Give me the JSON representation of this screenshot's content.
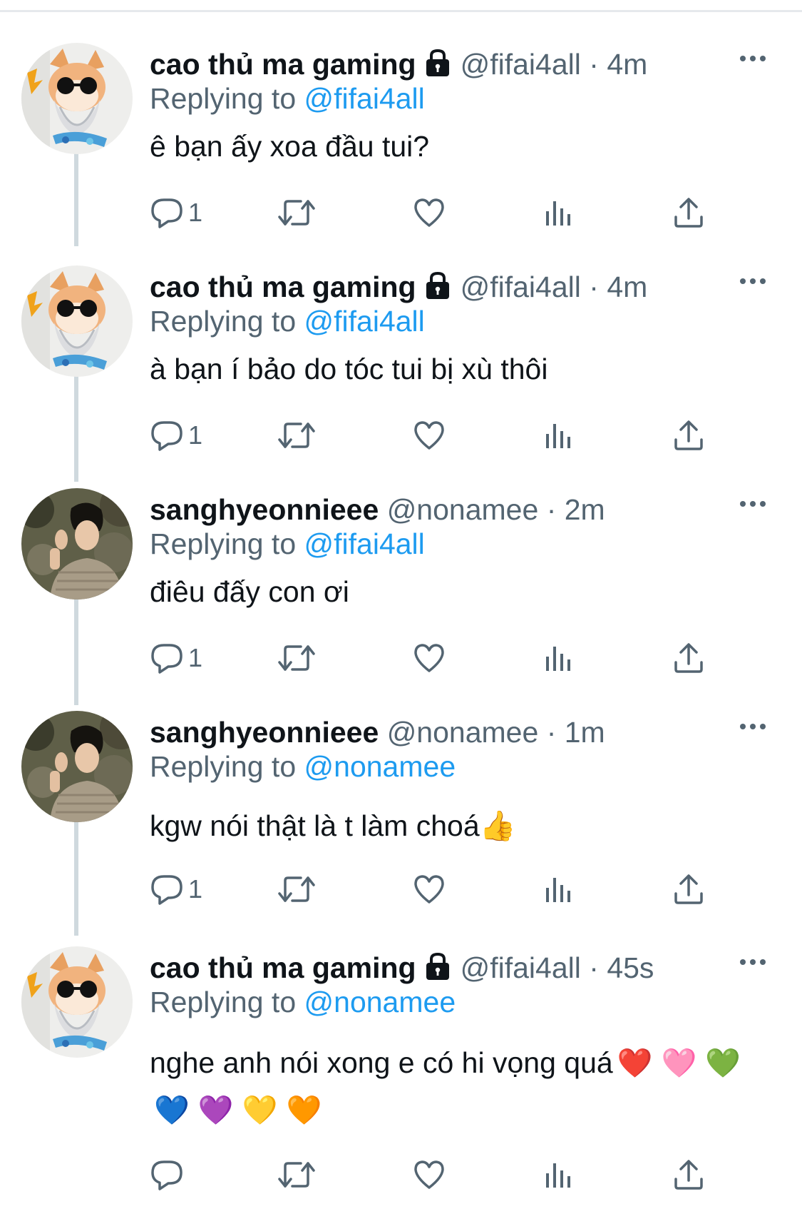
{
  "colors": {
    "text": "#0f1419",
    "secondary": "#536471",
    "accent": "#1d9bf0",
    "divider": "#e6e9ec",
    "thread_line": "#cfd9de"
  },
  "tweets": [
    {
      "name": "cao thủ ma gaming",
      "locked": true,
      "handle": "@fifai4all",
      "dot": "·",
      "time": "4m",
      "replying_label": "Replying to",
      "replying_to": "@fifai4all",
      "text": "ê bạn ấy xoa đầu tui?",
      "reply_count": "1",
      "avatar": "cat-avatar"
    },
    {
      "name": "cao thủ ma gaming",
      "locked": true,
      "handle": "@fifai4all",
      "dot": "·",
      "time": "4m",
      "replying_label": "Replying to",
      "replying_to": "@fifai4all",
      "text": "à bạn í bảo do tóc tui bị xù thôi",
      "reply_count": "1",
      "avatar": "cat-avatar"
    },
    {
      "name": "sanghyeonnieee",
      "locked": false,
      "handle": "@nonamee",
      "dot": "·",
      "time": "2m",
      "replying_label": "Replying to",
      "replying_to": "@fifai4all",
      "text": "điêu đấy con ơi",
      "reply_count": "1",
      "avatar": "person-avatar"
    },
    {
      "name": "sanghyeonnieee",
      "locked": false,
      "handle": "@nonamee",
      "dot": "·",
      "time": "1m",
      "replying_label": "Replying to",
      "replying_to": "@nonamee",
      "text": "kgw nói thật là t làm choá",
      "text_emoji": "👍",
      "reply_count": "1",
      "avatar": "person-avatar"
    },
    {
      "name": "cao thủ ma gaming",
      "locked": true,
      "handle": "@fifai4all",
      "dot": "·",
      "time": "45s",
      "replying_label": "Replying to",
      "replying_to": "@nonamee",
      "text": "nghe anh nói xong e có hi vọng quá",
      "hearts": [
        "❤️",
        "🩷",
        "💚",
        "💙",
        "💜",
        "💛",
        "🧡"
      ],
      "reply_count": "",
      "avatar": "cat-avatar"
    }
  ]
}
